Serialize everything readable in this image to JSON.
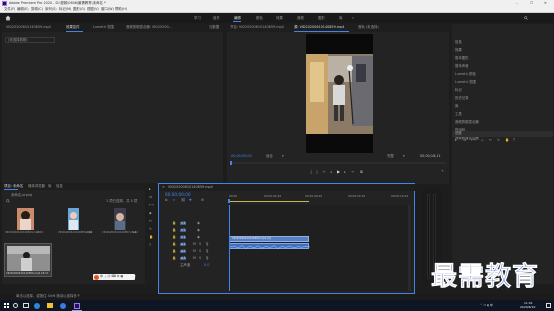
{
  "window": {
    "title": "Adobe Premiere Pro 2020 - D:\\视频\\0606\\最需教育\\未命名 *",
    "minimize": "–",
    "maximize": "☐",
    "close": "✕"
  },
  "menu": [
    "文件(F)",
    "编辑(E)",
    "剪辑(C)",
    "序列(S)",
    "标记(M)",
    "图形(G)",
    "视图(V)",
    "窗口(W)",
    "帮助(H)"
  ],
  "workspaces": [
    "学习",
    "组件",
    "编辑",
    "颜色",
    "效果",
    "音频",
    "图形",
    "库"
  ],
  "active_workspace_index": 2,
  "source_tabs": [
    "VID20200610140859.mp4",
    "效果控件",
    "Lumetri 范围",
    "音频剪辑混合器: VID20200...",
    "元数据"
  ],
  "source_empty": "(未选择剪辑)",
  "program": {
    "tabs": [
      "节目: VID20200610140859.mp4",
      "源: VID20200610140859.mp4",
      "音轨 (未选择)"
    ],
    "timecode_left": "00;00;00;00",
    "fit": "适合",
    "quality": "完整",
    "timecode_right": "00;00;18;11"
  },
  "project": {
    "tabs": [
      "项目: 未命名",
      "媒体浏览器",
      "库",
      "信息"
    ],
    "filename": "未命名.prproj",
    "item_count": "1 项已选择，共 5 项",
    "clips": [
      {
        "name": "VID20200610140844.mp4",
        "duration": "7:09"
      },
      {
        "name": "VID20200610140855.mp4",
        "duration": "2:06"
      },
      {
        "name": "VID20200610140857.mp4",
        "duration": "4:12"
      },
      {
        "name": "VID20200610140859.mp4",
        "duration": "18:11"
      }
    ]
  },
  "timeline": {
    "tab": "VID20200610140859.mp4",
    "timecode": "00;00;00;00",
    "ruler": [
      "00;00",
      "00;00;04;29",
      "00;00;09;29",
      "00;00;14;29",
      "00;00;19;29"
    ],
    "video_tracks": [
      "V3",
      "V2",
      "V1"
    ],
    "audio_tracks": [
      "A1",
      "A2",
      "A3"
    ],
    "master": "主声道",
    "master_value": "0.0",
    "clip_video": "VID20200610140859.mp4 [V]",
    "clip_audio": "",
    "clip_fraction_of_ruler": 0.4
  },
  "effects_panel": {
    "items": [
      "信息",
      "效果",
      "基本图形",
      "基本声音",
      "Lumetri 颜色",
      "Lumetri 范围",
      "标记",
      "历史记录",
      "库",
      "工具",
      "音频剪辑混合器",
      "时间码",
      "音频轨道混合器",
      "进度"
    ],
    "highlighted": "进度"
  },
  "watermark": "最需教育",
  "taskbar": {
    "status": "单击以选择，或按住 Shift 拖动以选择多个",
    "time": "11:01",
    "date": "2020/6/10"
  },
  "colors": {
    "accent": "#3f86e8",
    "playhead": "#3f86e8",
    "clip": "#5a7fbf",
    "watermark": "#2c54c8"
  }
}
